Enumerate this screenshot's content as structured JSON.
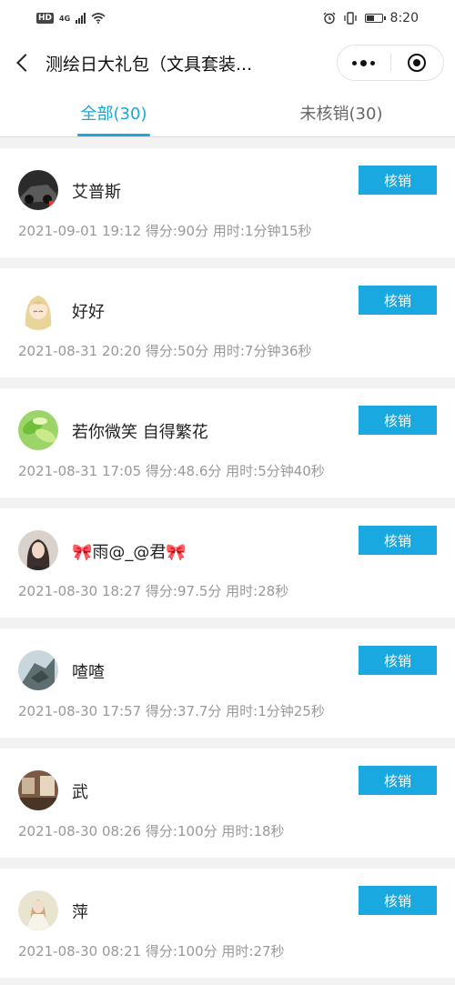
{
  "status_bar": {
    "hd": "HD",
    "network": "4G",
    "time": "8:20"
  },
  "nav": {
    "title": "测绘日大礼包（文具套装..."
  },
  "tabs": [
    {
      "label": "全部(30)",
      "active": true
    },
    {
      "label": "未核销(30)",
      "active": false
    }
  ],
  "items": [
    {
      "name": "艾普斯",
      "meta": "2021-09-01 19:12 得分:90分 用时:1分钟15秒",
      "button": "核销",
      "avatar": "car-photo"
    },
    {
      "name": "好好",
      "meta": "2021-08-31 20:20 得分:50分 用时:7分钟36秒",
      "button": "核销",
      "avatar": "anime-girl"
    },
    {
      "name": "若你微笑 自得繁花",
      "meta": "2021-08-31 17:05 得分:48.6分 用时:5分钟40秒",
      "button": "核销",
      "avatar": "green-leaves"
    },
    {
      "name": "雨@_@君",
      "meta": "2021-08-30 18:27 得分:97.5分 用时:28秒",
      "button": "核销",
      "avatar": "portrait-woman"
    },
    {
      "name": "喳喳",
      "meta": "2021-08-30 17:57 得分:37.7分 用时:1分钟25秒",
      "button": "核销",
      "avatar": "sculpture"
    },
    {
      "name": "武",
      "meta": "2021-08-30 08:26 得分:100分 用时:18秒",
      "button": "核销",
      "avatar": "room-interior"
    },
    {
      "name": "萍",
      "meta": "2021-08-30 08:21 得分:100分 用时:27秒",
      "button": "核销",
      "avatar": "girl-outdoor"
    }
  ],
  "colors": {
    "accent": "#1aa8d8",
    "button": "#1aa8e0"
  }
}
